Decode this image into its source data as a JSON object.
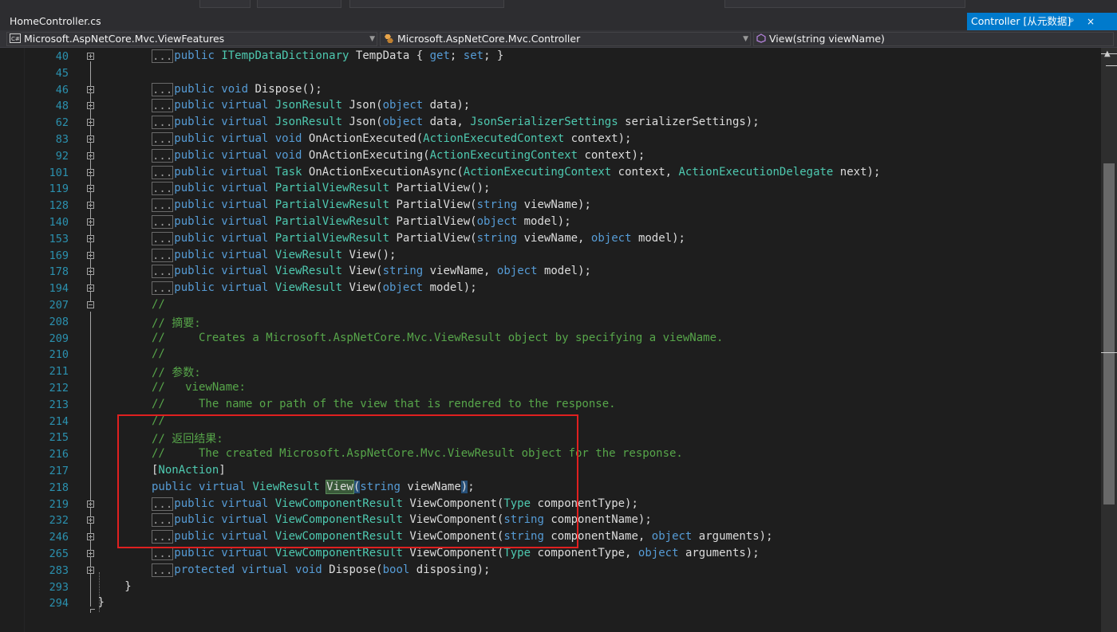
{
  "tabs": {
    "file": "HomeController.cs",
    "tool_window": "Controller [从元数据]",
    "pin": "ᵖ",
    "close": "×"
  },
  "nav": {
    "project": "Microsoft.AspNetCore.Mvc.ViewFeatures",
    "type": "Microsoft.AspNetCore.Mvc.Controller",
    "member": "View(string viewName)"
  },
  "collapsed_marker": "...",
  "lines": [
    {
      "num": "40",
      "fold": "plus",
      "collapsed": true,
      "tokens": [
        [
          "kw",
          "public "
        ],
        [
          "ty",
          "ITempDataDictionary "
        ],
        [
          "pl",
          "TempData { "
        ],
        [
          "kw",
          "get"
        ],
        [
          "pl",
          "; "
        ],
        [
          "kw",
          "set"
        ],
        [
          "pl",
          "; }"
        ]
      ]
    },
    {
      "num": "45",
      "fold": "none",
      "collapsed": false,
      "tokens": []
    },
    {
      "num": "46",
      "fold": "plus",
      "collapsed": true,
      "tokens": [
        [
          "kw",
          "public void "
        ],
        [
          "pl",
          "Dispose();"
        ]
      ]
    },
    {
      "num": "48",
      "fold": "plus",
      "collapsed": true,
      "tokens": [
        [
          "kw",
          "public virtual "
        ],
        [
          "ty",
          "JsonResult "
        ],
        [
          "pl",
          "Json("
        ],
        [
          "kw",
          "object "
        ],
        [
          "pl",
          "data);"
        ]
      ]
    },
    {
      "num": "62",
      "fold": "plus",
      "collapsed": true,
      "tokens": [
        [
          "kw",
          "public virtual "
        ],
        [
          "ty",
          "JsonResult "
        ],
        [
          "pl",
          "Json("
        ],
        [
          "kw",
          "object "
        ],
        [
          "pl",
          "data, "
        ],
        [
          "ty",
          "JsonSerializerSettings "
        ],
        [
          "pl",
          "serializerSettings);"
        ]
      ]
    },
    {
      "num": "83",
      "fold": "plus",
      "collapsed": true,
      "tokens": [
        [
          "kw",
          "public virtual void "
        ],
        [
          "pl",
          "OnActionExecuted("
        ],
        [
          "ty",
          "ActionExecutedContext "
        ],
        [
          "pl",
          "context);"
        ]
      ]
    },
    {
      "num": "92",
      "fold": "plus",
      "collapsed": true,
      "tokens": [
        [
          "kw",
          "public virtual void "
        ],
        [
          "pl",
          "OnActionExecuting("
        ],
        [
          "ty",
          "ActionExecutingContext "
        ],
        [
          "pl",
          "context);"
        ]
      ]
    },
    {
      "num": "101",
      "fold": "plus",
      "collapsed": true,
      "tokens": [
        [
          "kw",
          "public virtual "
        ],
        [
          "ty",
          "Task "
        ],
        [
          "pl",
          "OnActionExecutionAsync("
        ],
        [
          "ty",
          "ActionExecutingContext "
        ],
        [
          "pl",
          "context, "
        ],
        [
          "ty",
          "ActionExecutionDelegate "
        ],
        [
          "pl",
          "next);"
        ]
      ]
    },
    {
      "num": "119",
      "fold": "plus",
      "collapsed": true,
      "tokens": [
        [
          "kw",
          "public virtual "
        ],
        [
          "ty",
          "PartialViewResult "
        ],
        [
          "pl",
          "PartialView();"
        ]
      ]
    },
    {
      "num": "128",
      "fold": "plus",
      "collapsed": true,
      "tokens": [
        [
          "kw",
          "public virtual "
        ],
        [
          "ty",
          "PartialViewResult "
        ],
        [
          "pl",
          "PartialView("
        ],
        [
          "kw",
          "string "
        ],
        [
          "pl",
          "viewName);"
        ]
      ]
    },
    {
      "num": "140",
      "fold": "plus",
      "collapsed": true,
      "tokens": [
        [
          "kw",
          "public virtual "
        ],
        [
          "ty",
          "PartialViewResult "
        ],
        [
          "pl",
          "PartialView("
        ],
        [
          "kw",
          "object "
        ],
        [
          "pl",
          "model);"
        ]
      ]
    },
    {
      "num": "153",
      "fold": "plus",
      "collapsed": true,
      "tokens": [
        [
          "kw",
          "public virtual "
        ],
        [
          "ty",
          "PartialViewResult "
        ],
        [
          "pl",
          "PartialView("
        ],
        [
          "kw",
          "string "
        ],
        [
          "pl",
          "viewName, "
        ],
        [
          "kw",
          "object "
        ],
        [
          "pl",
          "model);"
        ]
      ]
    },
    {
      "num": "169",
      "fold": "plus",
      "collapsed": true,
      "tokens": [
        [
          "kw",
          "public virtual "
        ],
        [
          "ty",
          "ViewResult "
        ],
        [
          "pl",
          "View();"
        ]
      ]
    },
    {
      "num": "178",
      "fold": "plus",
      "collapsed": true,
      "tokens": [
        [
          "kw",
          "public virtual "
        ],
        [
          "ty",
          "ViewResult "
        ],
        [
          "pl",
          "View("
        ],
        [
          "kw",
          "string "
        ],
        [
          "pl",
          "viewName, "
        ],
        [
          "kw",
          "object "
        ],
        [
          "pl",
          "model);"
        ]
      ]
    },
    {
      "num": "194",
      "fold": "plus",
      "collapsed": true,
      "tokens": [
        [
          "kw",
          "public virtual "
        ],
        [
          "ty",
          "ViewResult "
        ],
        [
          "pl",
          "View("
        ],
        [
          "kw",
          "object "
        ],
        [
          "pl",
          "model);"
        ]
      ]
    },
    {
      "num": "207",
      "fold": "minus",
      "collapsed": false,
      "tokens": [
        [
          "pl",
          "        "
        ],
        [
          "cm",
          "//"
        ]
      ]
    },
    {
      "num": "208",
      "fold": "none",
      "collapsed": false,
      "tokens": [
        [
          "pl",
          "        "
        ],
        [
          "cm",
          "// 摘要:"
        ]
      ]
    },
    {
      "num": "209",
      "fold": "none",
      "collapsed": false,
      "tokens": [
        [
          "pl",
          "        "
        ],
        [
          "cm",
          "//     Creates a Microsoft.AspNetCore.Mvc.ViewResult object by specifying a viewName."
        ]
      ]
    },
    {
      "num": "210",
      "fold": "none",
      "collapsed": false,
      "tokens": [
        [
          "pl",
          "        "
        ],
        [
          "cm",
          "//"
        ]
      ]
    },
    {
      "num": "211",
      "fold": "none",
      "collapsed": false,
      "tokens": [
        [
          "pl",
          "        "
        ],
        [
          "cm",
          "// 参数:"
        ]
      ]
    },
    {
      "num": "212",
      "fold": "none",
      "collapsed": false,
      "tokens": [
        [
          "pl",
          "        "
        ],
        [
          "cm",
          "//   viewName:"
        ]
      ]
    },
    {
      "num": "213",
      "fold": "none",
      "collapsed": false,
      "tokens": [
        [
          "pl",
          "        "
        ],
        [
          "cm",
          "//     The name or path of the view that is rendered to the response."
        ]
      ]
    },
    {
      "num": "214",
      "fold": "none",
      "collapsed": false,
      "tokens": [
        [
          "pl",
          "        "
        ],
        [
          "cm",
          "//"
        ]
      ]
    },
    {
      "num": "215",
      "fold": "none",
      "collapsed": false,
      "tokens": [
        [
          "pl",
          "        "
        ],
        [
          "cm",
          "// 返回结果:"
        ]
      ]
    },
    {
      "num": "216",
      "fold": "none",
      "collapsed": false,
      "tokens": [
        [
          "pl",
          "        "
        ],
        [
          "cm",
          "//     The created Microsoft.AspNetCore.Mvc.ViewResult object for the response."
        ]
      ]
    },
    {
      "num": "217",
      "fold": "none",
      "collapsed": false,
      "tokens": [
        [
          "pl",
          "        ["
        ],
        [
          "ty",
          "NonAction"
        ],
        [
          "pl",
          "]"
        ]
      ]
    },
    {
      "num": "218",
      "fold": "none",
      "collapsed": false,
      "tokens": [
        [
          "pl",
          "        "
        ],
        [
          "kw",
          "public virtual "
        ],
        [
          "ty",
          "ViewResult "
        ],
        [
          "hlv",
          "View"
        ],
        [
          "hl",
          "("
        ],
        [
          "kw",
          "string "
        ],
        [
          "pl",
          "viewName"
        ],
        [
          "hl",
          ")"
        ],
        [
          "pl",
          ";"
        ]
      ]
    },
    {
      "num": "219",
      "fold": "plus",
      "collapsed": true,
      "tokens": [
        [
          "kw",
          "public virtual "
        ],
        [
          "ty",
          "ViewComponentResult "
        ],
        [
          "pl",
          "ViewComponent("
        ],
        [
          "ty",
          "Type "
        ],
        [
          "pl",
          "componentType);"
        ]
      ]
    },
    {
      "num": "232",
      "fold": "plus",
      "collapsed": true,
      "tokens": [
        [
          "kw",
          "public virtual "
        ],
        [
          "ty",
          "ViewComponentResult "
        ],
        [
          "pl",
          "ViewComponent("
        ],
        [
          "kw",
          "string "
        ],
        [
          "pl",
          "componentName);"
        ]
      ]
    },
    {
      "num": "246",
      "fold": "plus",
      "collapsed": true,
      "tokens": [
        [
          "kw",
          "public virtual "
        ],
        [
          "ty",
          "ViewComponentResult "
        ],
        [
          "pl",
          "ViewComponent("
        ],
        [
          "kw",
          "string "
        ],
        [
          "pl",
          "componentName, "
        ],
        [
          "kw",
          "object "
        ],
        [
          "pl",
          "arguments);"
        ]
      ]
    },
    {
      "num": "265",
      "fold": "plus",
      "collapsed": true,
      "tokens": [
        [
          "kw",
          "public virtual "
        ],
        [
          "ty",
          "ViewComponentResult "
        ],
        [
          "pl",
          "ViewComponent("
        ],
        [
          "ty",
          "Type "
        ],
        [
          "pl",
          "componentType, "
        ],
        [
          "kw",
          "object "
        ],
        [
          "pl",
          "arguments);"
        ]
      ]
    },
    {
      "num": "283",
      "fold": "plus",
      "collapsed": true,
      "tokens": [
        [
          "kw",
          "protected virtual void "
        ],
        [
          "pl",
          "Dispose("
        ],
        [
          "kw",
          "bool "
        ],
        [
          "pl",
          "disposing);"
        ]
      ]
    },
    {
      "num": "293",
      "fold": "none",
      "collapsed": false,
      "tokens": [
        [
          "pl",
          "    }"
        ]
      ]
    },
    {
      "num": "294",
      "fold": "none",
      "collapsed": false,
      "tokens": [
        [
          "pl",
          "}"
        ]
      ]
    }
  ],
  "colors": {
    "keyword": "#569cd6",
    "type": "#4ec9b0",
    "comment": "#57a64a",
    "plain": "#dcdcdc",
    "line_number": "#2b91af",
    "annotation_box": "#e02020",
    "tab_active": "#007acc"
  }
}
